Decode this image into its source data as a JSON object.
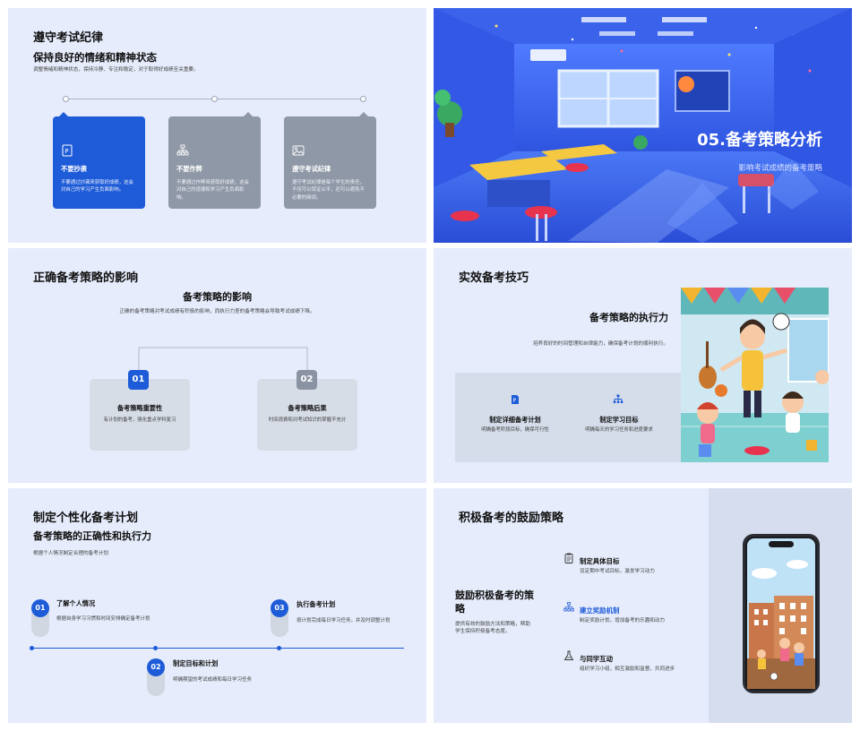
{
  "slide1": {
    "title": "遵守考试纪律",
    "subtitle": "保持良好的情绪和精神状态",
    "desc": "调整情绪和精神状态，保持冷静、专注和稳定，对于取得好成绩至关重要。",
    "cards": [
      {
        "title": "不要抄袭",
        "text": "不要通过抄袭来获取好成绩，这会对自己的学习产生负面影响。",
        "icon": "document-icon",
        "color": "#1e5bd8"
      },
      {
        "title": "不要作弊",
        "text": "不要通过作弊来获取好成绩，这会对自己的道德和学习产生负面影响。",
        "icon": "org-chart-icon",
        "color": "#8f98a6"
      },
      {
        "title": "遵守考试纪律",
        "text": "遵守考试纪律是每个学生的责任，不仅可以保证公平，还可以避免不必要的麻烦。",
        "icon": "image-icon",
        "color": "#8f98a6"
      }
    ]
  },
  "slide2": {
    "title": "05.备考策略分析",
    "subtitle": "影响考试成绩的备考策略"
  },
  "slide3": {
    "title": "正确备考策略的影响",
    "subtitle": "备考策略的影响",
    "desc": "正确的备考策略对考试成绩有积极的影响，而执行力差的备考策略会导致考试成绩下降。",
    "boxes": [
      {
        "num": "01",
        "title": "备考策略重要性",
        "text": "有计划的备考，强化重点学科复习",
        "color": "#1e5bd8"
      },
      {
        "num": "02",
        "title": "备考策略后果",
        "text": "时间浪费和对考试知识的掌握不充分",
        "color": "#8a93a2"
      }
    ]
  },
  "slide4": {
    "title": "实效备考技巧",
    "subtitle": "备考策略的执行力",
    "desc": "培养良好的时间管理和自律能力，确保备考计划的顺利执行。",
    "items": [
      {
        "title": "制定详细备考计划",
        "text": "明确备考阶段目标，确保可行性",
        "icon": "document-icon"
      },
      {
        "title": "制定学习目标",
        "text": "明确每天的学习任务和进度要求",
        "icon": "org-chart-icon"
      }
    ]
  },
  "slide5": {
    "title": "制定个性化备考计划",
    "subtitle": "备考策略的正确性和执行力",
    "desc": "根据个人情况制定合理的备考计划",
    "steps": [
      {
        "num": "01",
        "title": "了解个人情况",
        "text": "根据自身学习习惯和时间安排确定备考计划"
      },
      {
        "num": "02",
        "title": "制定目标和计划",
        "text": "明确期望的考试成绩和每日学习任务"
      },
      {
        "num": "03",
        "title": "执行备考计划",
        "text": "按计划完成每日学习任务，并及时调整计划"
      }
    ]
  },
  "slide6": {
    "title": "积极备考的鼓励策略",
    "subtitle": "鼓励积极备考的策略",
    "desc": "提供有效的鼓励方法和策略，帮助学生保持积极备考态度。",
    "features": [
      {
        "title": "制定具体目标",
        "text": "设定期中考试目标，激发学习动力",
        "icon": "clipboard-icon",
        "highlight": false
      },
      {
        "title": "建立奖励机制",
        "text": "制定奖励计划，增加备考的乐趣和动力",
        "icon": "org-chart-icon",
        "highlight": true
      },
      {
        "title": "与同学互动",
        "text": "组织学习小组，相互激励和监督，共同进步",
        "icon": "flask-icon",
        "highlight": false
      }
    ]
  },
  "colors": {
    "accent": "#1e5bd8",
    "slide_bg": "#e6ecfb",
    "gray_card": "#8f98a6"
  }
}
